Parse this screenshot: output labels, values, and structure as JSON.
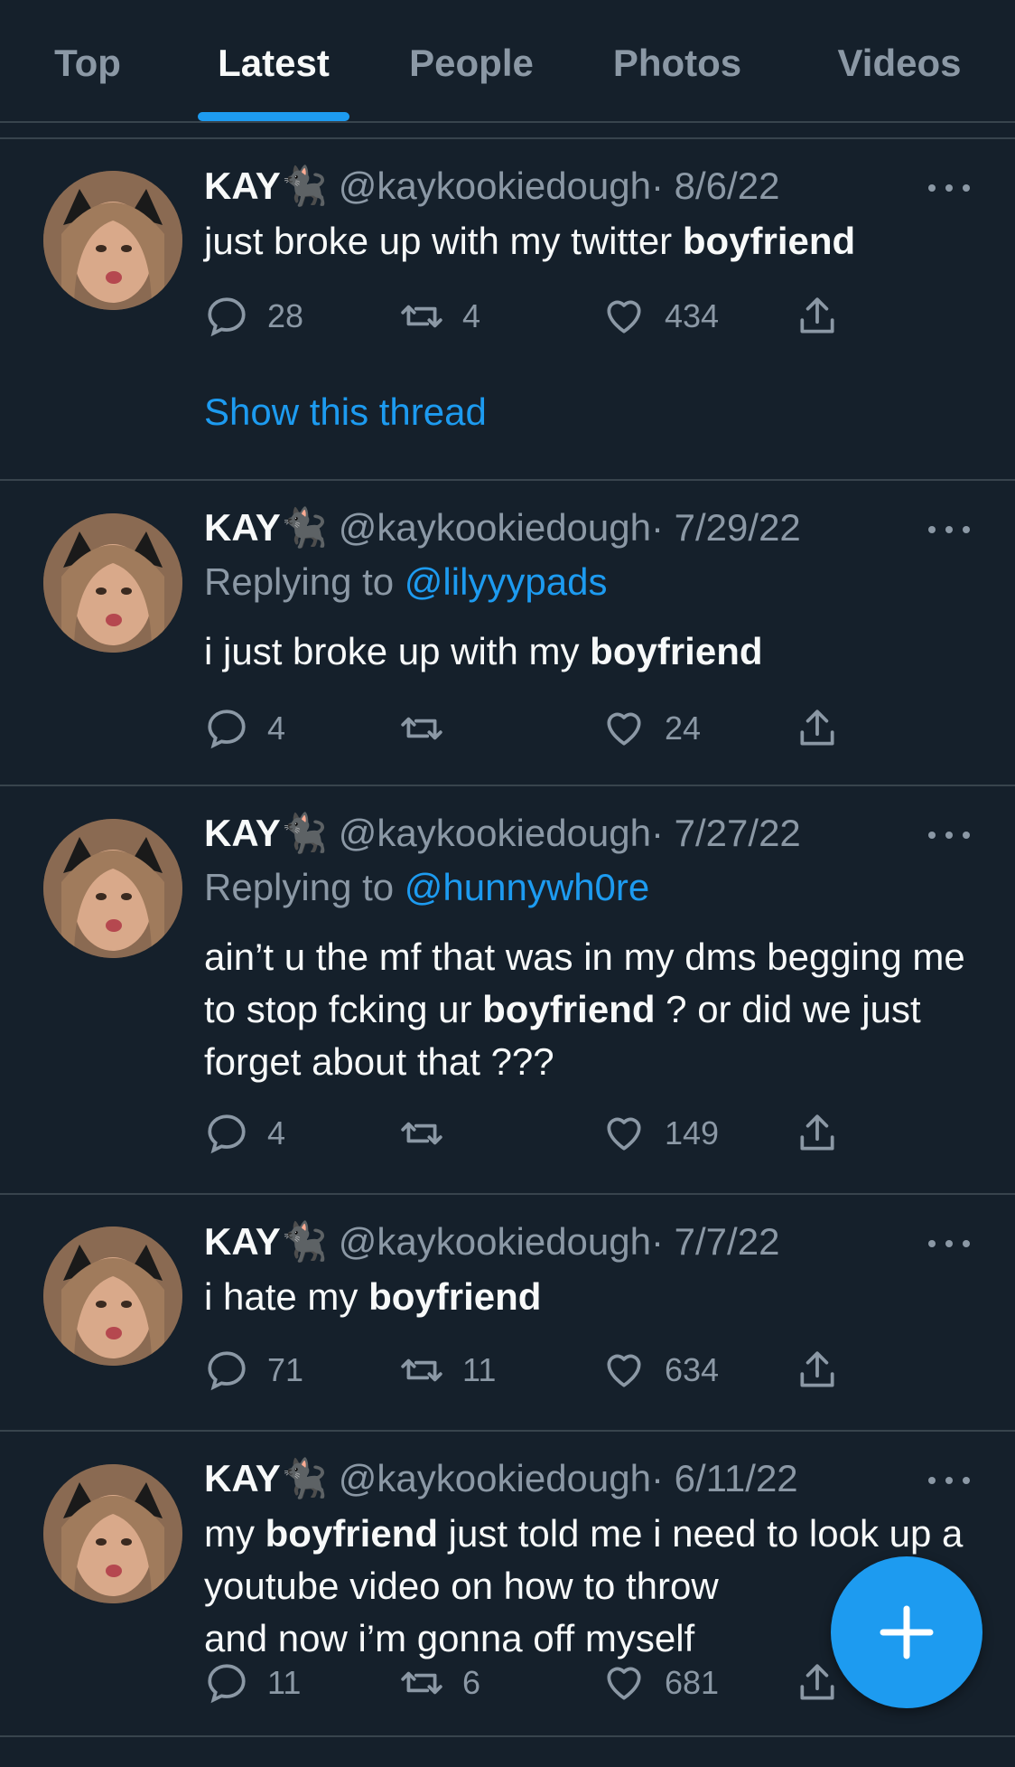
{
  "tabs": [
    "Top",
    "Latest",
    "People",
    "Photos",
    "Videos"
  ],
  "active_tab": "Latest",
  "accent": "#1d9bf0",
  "background": "#15202b",
  "fab_icon": "plus-icon",
  "tweets": [
    {
      "name": "KAY",
      "emoji": "🐈‍⬛",
      "handle": "@kaykookiedough",
      "date": "· 8/6/22",
      "replying_prefix": "",
      "replying_to": "",
      "text_parts": [
        {
          "t": "just broke up with my twitter ",
          "b": false
        },
        {
          "t": "boyfriend",
          "b": true
        }
      ],
      "replies": "28",
      "retweets": "4",
      "likes": "434",
      "thread_link": "Show this thread"
    },
    {
      "name": "KAY",
      "emoji": "🐈‍⬛",
      "handle": "@kaykookiedough",
      "date": "· 7/29/22",
      "replying_prefix": "Replying to ",
      "replying_to": "@lilyyypads",
      "text_parts": [
        {
          "t": "i just broke up with my ",
          "b": false
        },
        {
          "t": "boyfriend",
          "b": true
        }
      ],
      "replies": "4",
      "retweets": "",
      "likes": "24"
    },
    {
      "name": "KAY",
      "emoji": "🐈‍⬛",
      "handle": "@kaykookiedough",
      "date": "· 7/27/22",
      "replying_prefix": "Replying to ",
      "replying_to": "@hunnywh0re",
      "text_parts": [
        {
          "t": "ain’t u the mf that was in my dms begging me to stop fcking ur ",
          "b": false
        },
        {
          "t": "boyfriend",
          "b": true
        },
        {
          "t": " ? or did we just forget about that ???",
          "b": false
        }
      ],
      "replies": "4",
      "retweets": "",
      "likes": "149"
    },
    {
      "name": "KAY",
      "emoji": "🐈‍⬛",
      "handle": "@kaykookiedough",
      "date": "· 7/7/22",
      "replying_prefix": "",
      "replying_to": "",
      "text_parts": [
        {
          "t": "i hate my ",
          "b": false
        },
        {
          "t": "boyfriend",
          "b": true
        }
      ],
      "replies": "71",
      "retweets": "11",
      "likes": "634"
    },
    {
      "name": "KAY",
      "emoji": "🐈‍⬛",
      "handle": "@kaykookiedough",
      "date": "· 6/11/22",
      "replying_prefix": "",
      "replying_to": "",
      "text_parts": [
        {
          "t": "my ",
          "b": false
        },
        {
          "t": "boyfriend",
          "b": true
        },
        {
          "t": " just told me i need to look up a youtube video on how to throw",
          "b": false
        },
        {
          "t": "\nand now i’m gonna off myself",
          "b": false
        }
      ],
      "replies": "11",
      "retweets": "6",
      "likes": "681"
    }
  ]
}
